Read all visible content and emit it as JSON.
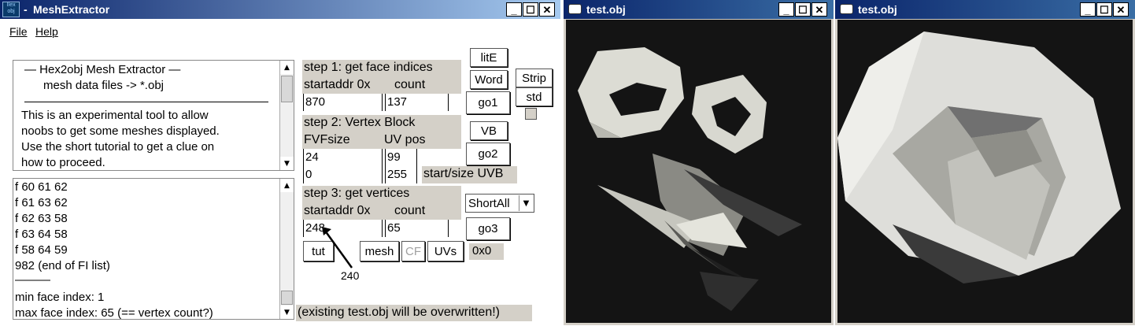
{
  "main_window": {
    "title": "MeshExtractor",
    "title_prefix": "- ",
    "app_icon_text": [
      "IIex",
      "obj"
    ],
    "menu": [
      "File",
      "Help"
    ]
  },
  "info_panel": {
    "lines": [
      "—   Hex2obj Mesh Extractor   —",
      "mesh data files -> *.obj",
      "This is an experimental tool to allow",
      "noobs to get some meshes displayed.",
      "Use the short tutorial to get a clue on",
      "how to proceed."
    ]
  },
  "log_panel": {
    "lines": [
      "f  60 61 62",
      "f  61 63 62",
      "f  62 63 58",
      "f  63 64 58",
      "f  58 64 59",
      "982 (end of FI list)",
      "———",
      "min face index: 1",
      "max face index: 65 (== vertex count?)"
    ]
  },
  "step1": {
    "title": "step 1: get face indices",
    "label_addr": "startaddr 0x",
    "label_count": "count",
    "addr": "870",
    "count": "137"
  },
  "step2": {
    "title": "step 2: Vertex Block",
    "label_fvf": "FVFsize",
    "label_uv": "UV pos",
    "fvf": "24",
    "uv": "99",
    "start": "0",
    "size": "255",
    "uvb_label": "start/size UVB"
  },
  "step3": {
    "title": "step 3: get vertices",
    "label_addr": "startaddr 0x",
    "label_count": "count",
    "addr": "248",
    "count": "65"
  },
  "buttons": {
    "lite": "litE",
    "word": "Word",
    "strip": "Strip",
    "std": "std",
    "go1": "go1",
    "vb": "VB",
    "go2": "go2",
    "go3": "go3",
    "tut": "tut",
    "mesh": "mesh",
    "cf": "CF",
    "uvs": "UVs"
  },
  "dropdown_value": "ShortAll",
  "hex_readout": "0x0",
  "annotation": "240",
  "warning": "(existing test.obj will be overwritten!)",
  "viewer1": {
    "title": "test.obj"
  },
  "viewer2": {
    "title": "test.obj"
  }
}
